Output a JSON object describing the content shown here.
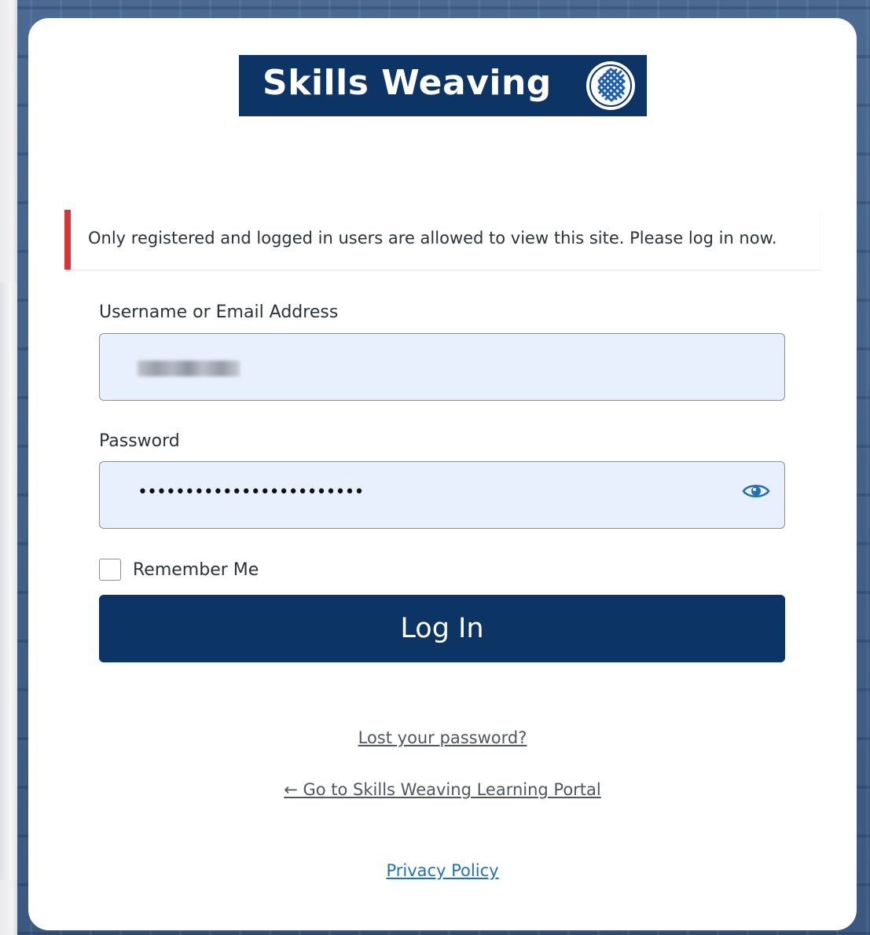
{
  "logo": {
    "text": "Skills Weaving",
    "badge_icon": "knot-weave-icon",
    "background_color": "#0c3566"
  },
  "notice": {
    "message": "Only registered and logged in users are allowed to view this site. Please log in now.",
    "accent_color": "#d63638"
  },
  "form": {
    "username_label": "Username or Email Address",
    "password_label": "Password",
    "password_mask": "••••••••••••••••••••••••",
    "remember_label": "Remember Me",
    "remember_checked": false,
    "show_password_icon": "eye-icon",
    "submit_label": "Log In",
    "button_color": "#0c3566",
    "field_fill_color": "#e8f0fe"
  },
  "links": {
    "lost_password": "Lost your password?",
    "back_to_site": "← Go to Skills Weaving Learning Portal",
    "privacy_policy": "Privacy Policy"
  }
}
